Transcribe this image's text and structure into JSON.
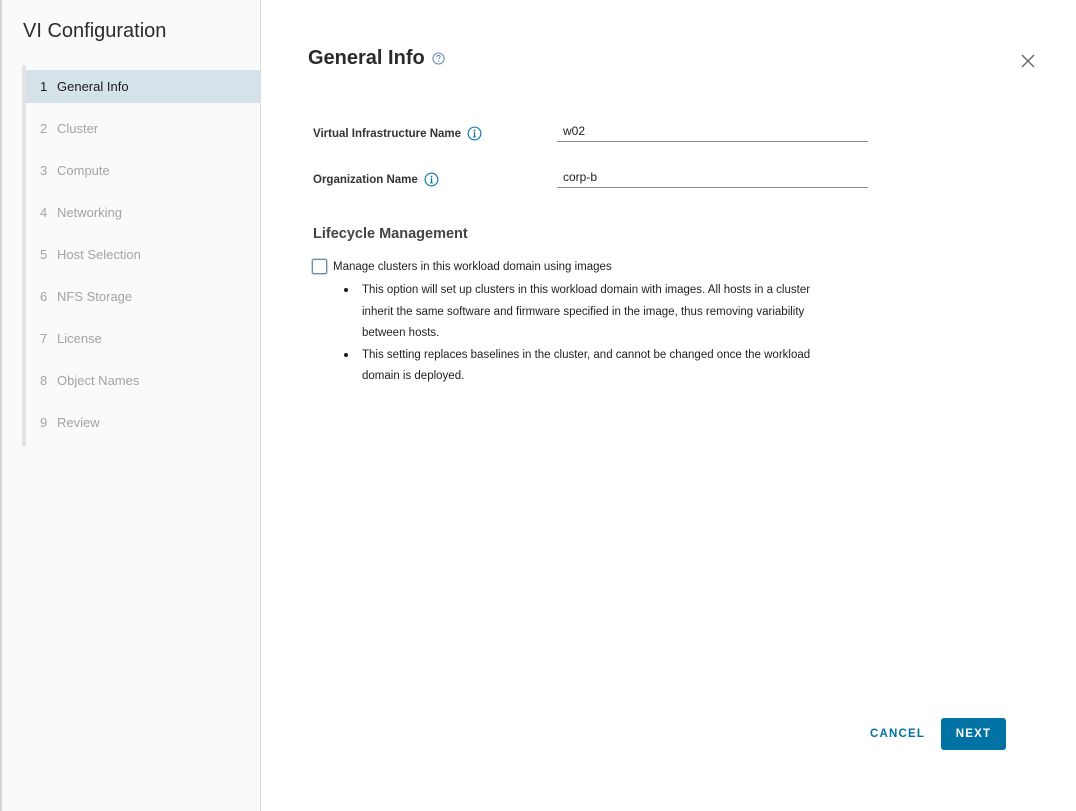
{
  "sidebar": {
    "title": "VI Configuration",
    "steps": [
      {
        "num": "1",
        "label": "General Info"
      },
      {
        "num": "2",
        "label": "Cluster"
      },
      {
        "num": "3",
        "label": "Compute"
      },
      {
        "num": "4",
        "label": "Networking"
      },
      {
        "num": "5",
        "label": "Host Selection"
      },
      {
        "num": "6",
        "label": "NFS Storage"
      },
      {
        "num": "7",
        "label": "License"
      },
      {
        "num": "8",
        "label": "Object Names"
      },
      {
        "num": "9",
        "label": "Review"
      }
    ],
    "active_step": 1
  },
  "main": {
    "title": "General Info",
    "fields": {
      "vi_name": {
        "label": "Virtual Infrastructure Name",
        "value": "w02"
      },
      "org_name": {
        "label": "Organization Name",
        "value": "corp-b"
      }
    },
    "lifecycle": {
      "title": "Lifecycle Management",
      "checkbox_label": "Manage clusters in this workload domain using images",
      "checked": false,
      "bullets": [
        "This option will set up clusters in this workload domain with images. All hosts in a cluster inherit the same software and firmware specified in the image, thus removing variability between hosts.",
        "This setting replaces baselines in the cluster, and cannot be changed once the workload domain is deployed."
      ]
    }
  },
  "footer": {
    "cancel_label": "CANCEL",
    "next_label": "NEXT"
  },
  "colors": {
    "accent": "#0072a3",
    "active_step_bg": "#d6e2ea",
    "info_icon": "#0072a3"
  },
  "icons": {
    "help": "help-circle-icon",
    "info": "info-circle-icon",
    "close": "close-icon"
  }
}
